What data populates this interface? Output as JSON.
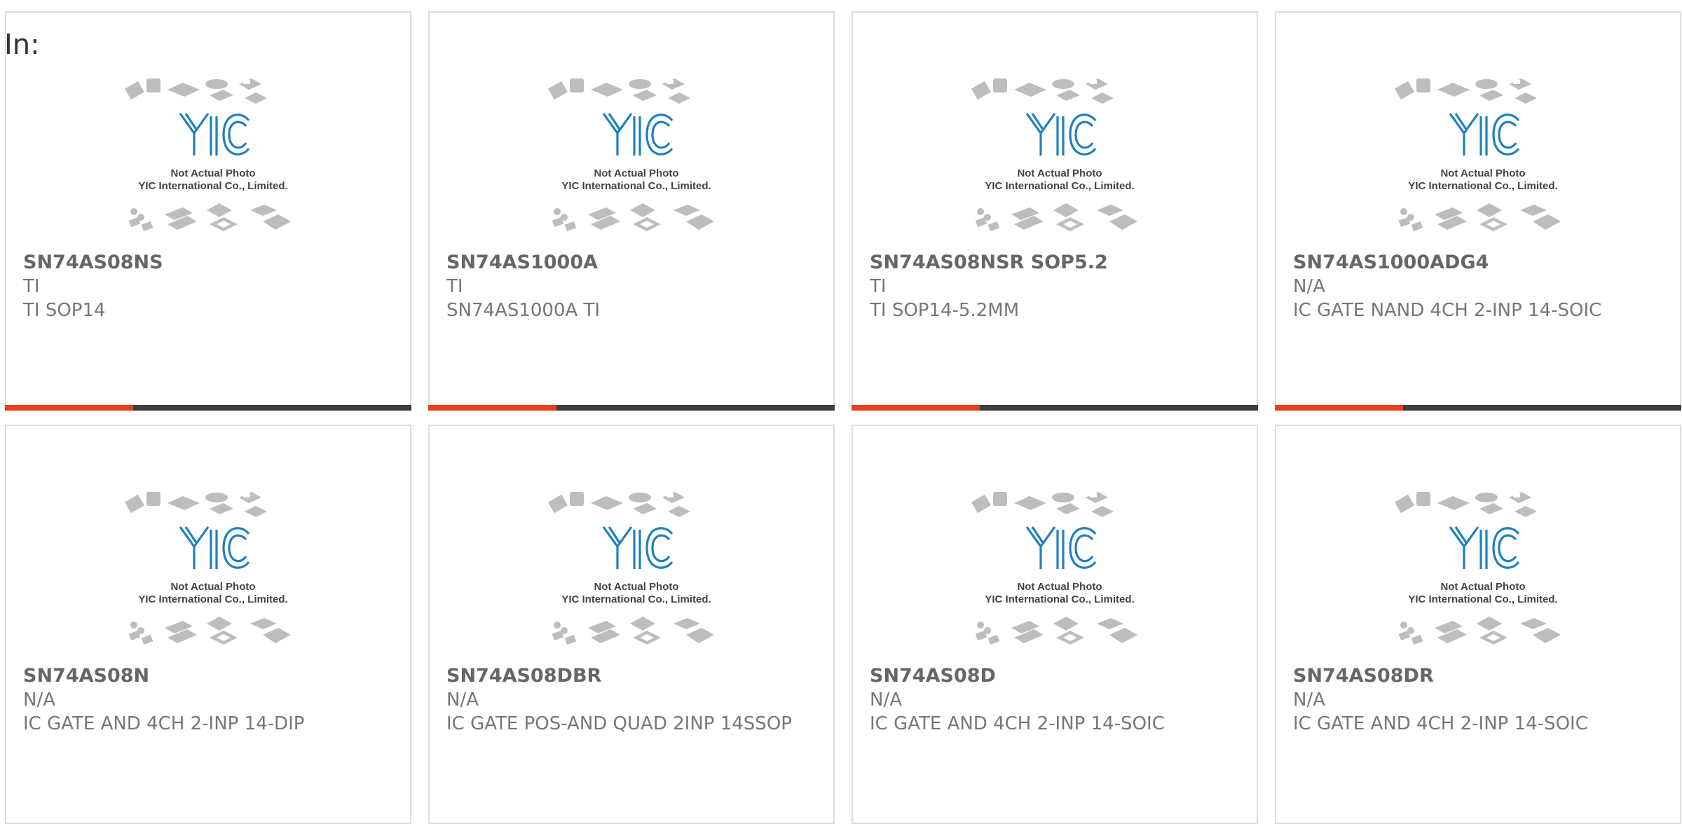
{
  "header": {
    "in_label": "In:"
  },
  "photo": {
    "logo_text": "YIC",
    "caption_line1": "Not Actual Photo",
    "caption_line2": "YIC International Co., Limited."
  },
  "colors": {
    "accent": "#e8401c",
    "bar": "#3d3d3d",
    "border": "#dcdcdc",
    "text": "#777777",
    "logo_blue": "#1e7fc0"
  },
  "products": [
    {
      "part": "SN74AS08NS",
      "maker": "TI",
      "desc": "TI SOP14"
    },
    {
      "part": "SN74AS1000A",
      "maker": "TI",
      "desc": "SN74AS1000A TI"
    },
    {
      "part": "SN74AS08NSR SOP5.2",
      "maker": "TI",
      "desc": "TI SOP14-5.2MM"
    },
    {
      "part": "SN74AS1000ADG4",
      "maker": "N/A",
      "desc": "IC GATE NAND 4CH 2-INP 14-SOIC"
    },
    {
      "part": "SN74AS08N",
      "maker": "N/A",
      "desc": "IC GATE AND 4CH 2-INP 14-DIP"
    },
    {
      "part": "SN74AS08DBR",
      "maker": "N/A",
      "desc": "IC GATE POS-AND QUAD 2INP 14SSOP"
    },
    {
      "part": "SN74AS08D",
      "maker": "N/A",
      "desc": "IC GATE AND 4CH 2-INP 14-SOIC"
    },
    {
      "part": "SN74AS08DR",
      "maker": "N/A",
      "desc": "IC GATE AND 4CH 2-INP 14-SOIC"
    }
  ]
}
